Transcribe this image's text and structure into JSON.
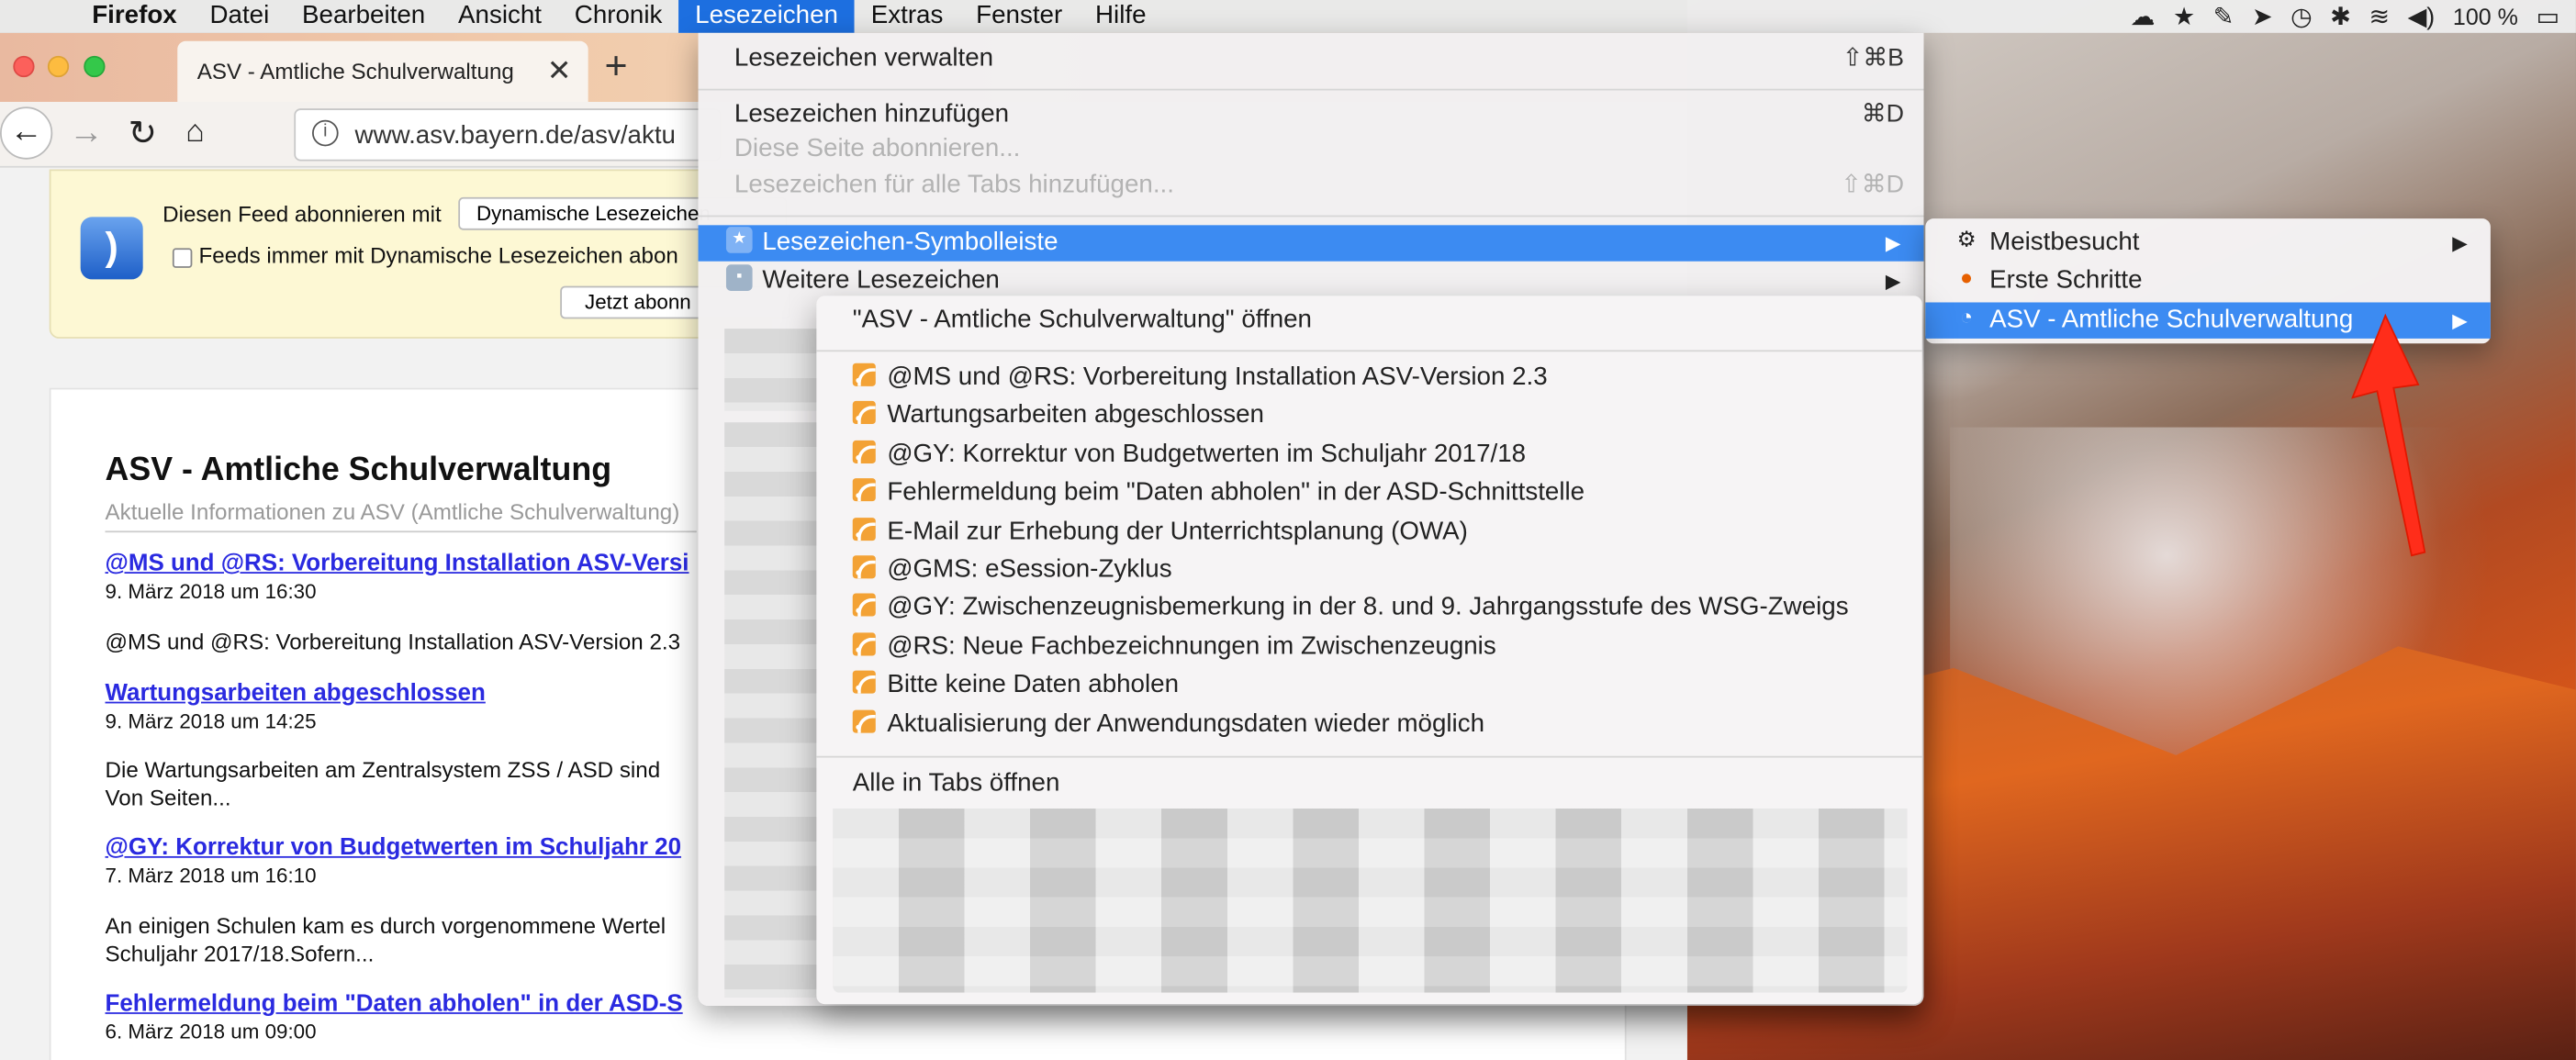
{
  "menubar": {
    "app": "Firefox",
    "items": [
      "Datei",
      "Bearbeiten",
      "Ansicht",
      "Chronik",
      "Lesezeichen",
      "Extras",
      "Fenster",
      "Hilfe"
    ],
    "active": "Lesezeichen",
    "battery": "100 %"
  },
  "browser": {
    "tab_title": "ASV - Amtliche Schulverwaltung",
    "url": "www.asv.bayern.de/asv/aktu",
    "feed": {
      "subscribe_label": "Diesen Feed abonnieren mit",
      "select_value": "Dynamische Lesezeichen",
      "checkbox_label": "Feeds immer mit Dynamische Lesezeichen abon",
      "button": "Jetzt abonn"
    },
    "article": {
      "title": "ASV - Amtliche Schulverwaltung",
      "subtitle": "Aktuelle Informationen zu ASV (Amtliche Schulverwaltung)",
      "entries": [
        {
          "link": "@MS und @RS: Vorbereitung Installation ASV-Versi",
          "date": "9. März 2018 um 16:30",
          "text1": "@MS und @RS: Vorbereitung Installation ASV-Version 2.3",
          "text2": ""
        },
        {
          "link": "Wartungsarbeiten abgeschlossen",
          "date": "9. März 2018 um 14:25",
          "text1": "Die Wartungsarbeiten am Zentralsystem ZSS / ASD sind",
          "text2": "Von Seiten..."
        },
        {
          "link": "@GY: Korrektur von Budgetwerten im Schuljahr 20",
          "date": "7. März 2018 um 16:10",
          "text1": "An einigen Schulen kam es durch vorgenommene Wertel",
          "text2": "Schuljahr 2017/18.Sofern..."
        },
        {
          "link": "Fehlermeldung beim \"Daten abholen\" in der ASD-S",
          "date": "6. März 2018 um 09:00",
          "text1": "",
          "text2": ""
        }
      ]
    }
  },
  "menu": {
    "manage": {
      "label": "Lesezeichen verwalten",
      "shortcut": "⇧⌘B"
    },
    "add": {
      "label": "Lesezeichen hinzufügen",
      "shortcut": "⌘D"
    },
    "subscribe": {
      "label": "Diese Seite abonnieren..."
    },
    "add_all": {
      "label": "Lesezeichen für alle Tabs hinzufügen...",
      "shortcut": "⇧⌘D"
    },
    "toolbar": {
      "label": "Lesezeichen-Symbolleiste"
    },
    "more": {
      "label": "Weitere Lesezeichen"
    }
  },
  "toolbar_submenu": [
    {
      "label": "Meistbesucht",
      "icon": "gear-icon"
    },
    {
      "label": "Erste Schritte",
      "icon": "firefox-icon"
    },
    {
      "label": "ASV - Amtliche Schulverwaltung",
      "icon": "rss-icon"
    }
  ],
  "feed_submenu": {
    "open_label": "\"ASV - Amtliche Schulverwaltung\" öffnen",
    "items": [
      "@MS und @RS: Vorbereitung Installation ASV-Version 2.3",
      "Wartungsarbeiten abgeschlossen",
      "@GY: Korrektur von Budgetwerten im Schuljahr 2017/18",
      "Fehlermeldung beim \"Daten abholen\" in der ASD-Schnittstelle",
      "E-Mail zur Erhebung der Unterrichtsplanung (OWA)",
      "@GMS: eSession-Zyklus",
      "@GY: Zwischenzeugnisbemerkung in der 8. und 9. Jahrgangsstufe des WSG-Zweigs",
      "@RS: Neue Fachbezeichnungen im Zwischenzeugnis",
      "Bitte keine Daten abholen",
      "Aktualisierung der Anwendungsdaten wieder möglich"
    ],
    "open_all_label": "Alle in Tabs öffnen"
  }
}
